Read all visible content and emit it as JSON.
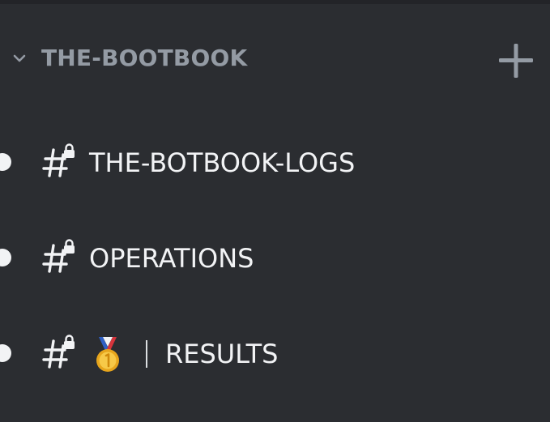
{
  "category": {
    "name": "THE-BOOTBOOK",
    "collapse_icon": "chevron-down-icon",
    "add_icon": "plus-icon"
  },
  "channels": [
    {
      "name": "THE-BOTBOOK-LOGS",
      "icon": "locked-text-channel-icon",
      "unread": true
    },
    {
      "name": "OPERATIONS",
      "icon": "locked-text-channel-icon",
      "unread": true
    },
    {
      "emoji_icon": "medal-icon",
      "separator": "|",
      "name": "RESULTS",
      "icon": "locked-text-channel-icon",
      "unread": true
    }
  ],
  "colors": {
    "background": "#2b2d31",
    "category_text": "#949ba4",
    "channel_text": "#f2f3f5"
  }
}
